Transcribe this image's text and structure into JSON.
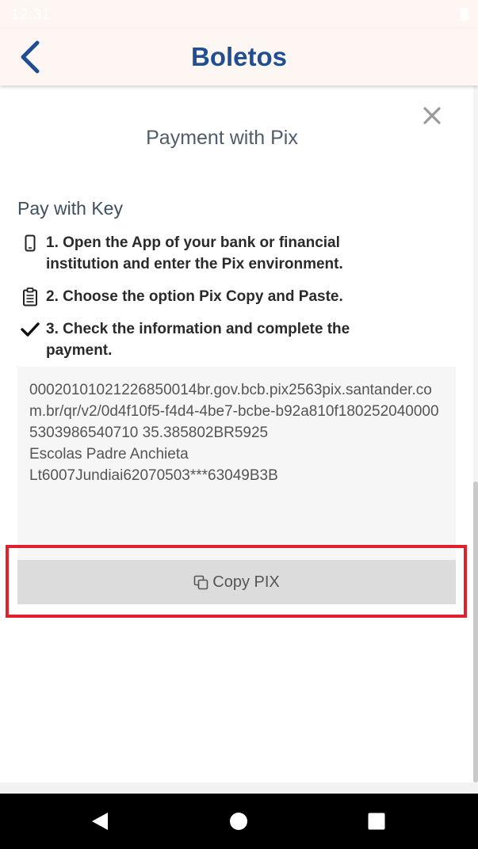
{
  "status": {
    "time": "12:31"
  },
  "app_bar": {
    "title": "Boletos",
    "back_icon": "chevron-left-icon"
  },
  "modal": {
    "title": "Payment with Pix",
    "close_icon": "close-icon",
    "section_title": "Pay with Key",
    "steps": [
      {
        "icon": "phone-icon",
        "text": "1. Open the App of your bank or financial institution and enter the Pix environment."
      },
      {
        "icon": "clipboard-icon",
        "text": "2. Choose the option Pix Copy and Paste."
      },
      {
        "icon": "check-icon",
        "text": "3. Check the information and complete the payment."
      }
    ],
    "pix_code": "00020101021226850014br.gov.bcb.pix2563pix.santander.com.br/qr/v2/0d4f10f5-f4d4-4be7-bcbe-b92a810f1802520400005303986540710 35.385802BR5925\nEscolas Padre Anchieta\nLt6007Jundiai62070503***63049B3B",
    "copy_button": {
      "label": "Copy PIX",
      "icon": "copy-icon"
    }
  },
  "nav": {
    "back_icon": "nav-back-icon",
    "home_icon": "nav-home-icon",
    "recent_icon": "nav-recent-icon"
  },
  "colors": {
    "title_blue": "#1f4f91",
    "highlight_red": "#e0202a",
    "button_gray": "#dcdcdc"
  }
}
